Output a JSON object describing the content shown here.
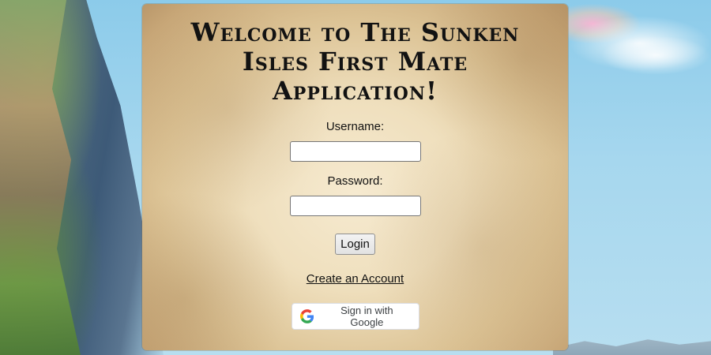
{
  "page": {
    "title": "Welcome to The Sunken Isles First Mate Application!"
  },
  "login_form": {
    "username_label": "Username:",
    "username_value": "",
    "password_label": "Password:",
    "password_value": "",
    "login_button": "Login",
    "create_account_link": "Create an Account",
    "google_button": "Sign in with Google",
    "google_icon": "google-g-icon"
  },
  "colors": {
    "parchment_center": "#f6ead0",
    "parchment_edge": "#b9976a",
    "title_text": "#121212",
    "sky": "#8ccbea"
  }
}
